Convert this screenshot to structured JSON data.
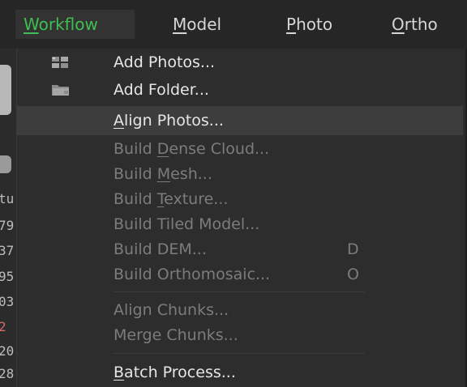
{
  "menubar": {
    "items": [
      {
        "label_u": "W",
        "label_rest": "orkflow",
        "active": true
      },
      {
        "label_u": "M",
        "label_rest": "odel",
        "active": false
      },
      {
        "label_u": "P",
        "label_rest": "hoto",
        "active": false
      },
      {
        "label_u": "O",
        "label_rest": "rtho",
        "active": false
      }
    ]
  },
  "left_strip": {
    "fragments": [
      "tu",
      "79",
      "37",
      "95",
      "03",
      "2",
      "20",
      "28"
    ]
  },
  "workflow_menu": {
    "items": [
      {
        "pre": "Add Photos...",
        "u": "",
        "post": "",
        "shortcut": "",
        "enabled": true,
        "icon": "add-photos-icon"
      },
      {
        "pre": "Add Folder...",
        "u": "",
        "post": "",
        "shortcut": "",
        "enabled": true,
        "icon": "add-folder-icon"
      },
      {
        "pre": "",
        "u": "A",
        "post": "lign Photos...",
        "shortcut": "",
        "enabled": true,
        "icon": ""
      },
      {
        "pre": "Build ",
        "u": "D",
        "post": "ense Cloud...",
        "shortcut": "",
        "enabled": false,
        "icon": ""
      },
      {
        "pre": "Build ",
        "u": "M",
        "post": "esh...",
        "shortcut": "",
        "enabled": false,
        "icon": ""
      },
      {
        "pre": "Build ",
        "u": "T",
        "post": "exture...",
        "shortcut": "",
        "enabled": false,
        "icon": ""
      },
      {
        "pre": "Build Tiled Model...",
        "u": "",
        "post": "",
        "shortcut": "",
        "enabled": false,
        "icon": ""
      },
      {
        "pre": "Build DEM...",
        "u": "",
        "post": "",
        "shortcut": "D",
        "enabled": false,
        "icon": ""
      },
      {
        "pre": "Build Orthomosaic...",
        "u": "",
        "post": "",
        "shortcut": "O",
        "enabled": false,
        "icon": ""
      },
      {
        "pre": "Align Chunks...",
        "u": "",
        "post": "",
        "shortcut": "",
        "enabled": false,
        "icon": ""
      },
      {
        "pre": "Merge Chunks...",
        "u": "",
        "post": "",
        "shortcut": "",
        "enabled": false,
        "icon": ""
      },
      {
        "pre": "",
        "u": "B",
        "post": "atch Process...",
        "shortcut": "",
        "enabled": true,
        "icon": ""
      }
    ]
  },
  "colors": {
    "active_menu_text": "#3fbf52",
    "enabled_text": "#e6e6e6",
    "disabled_text": "#7c7c7c",
    "highlight_row": "#3d3d3d"
  }
}
